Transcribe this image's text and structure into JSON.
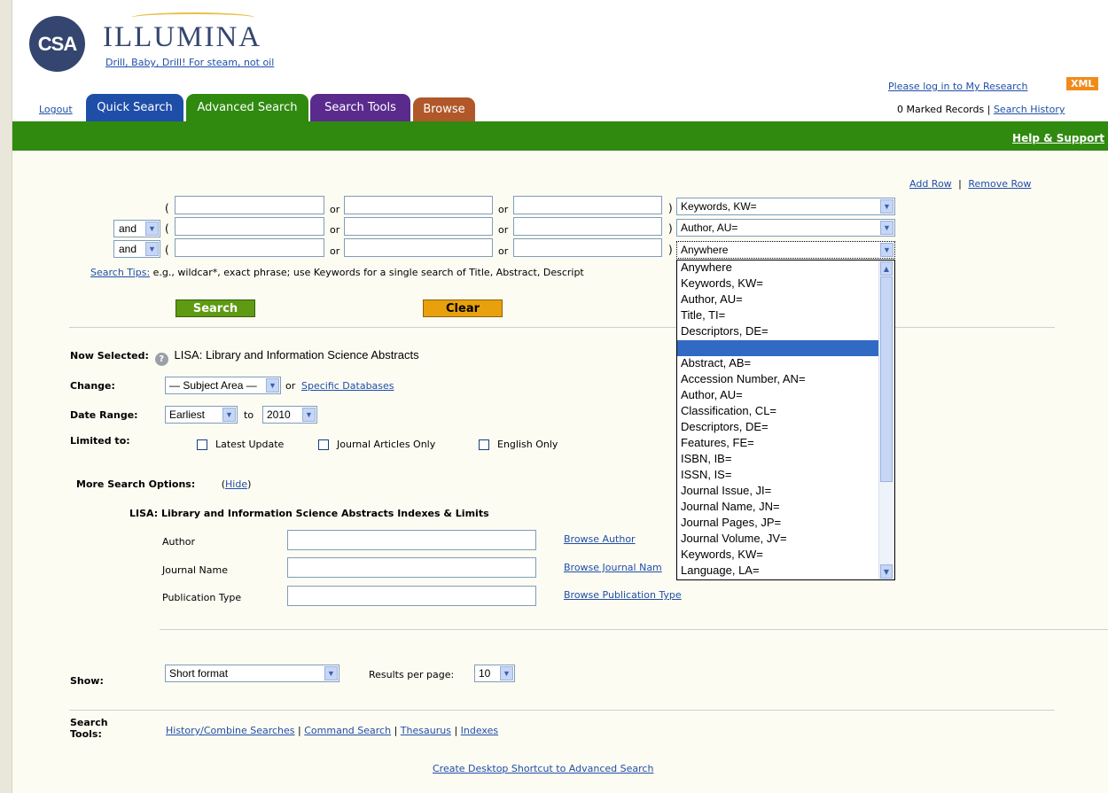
{
  "brand": {
    "logo": "CSA",
    "name": "ILLUMINA",
    "tagline": "Drill, Baby, Drill! For steam, not oil"
  },
  "nav": {
    "logout": "Logout",
    "tabs": [
      {
        "label": "Quick Search",
        "color": "#1f4ea8"
      },
      {
        "label": "Advanced Search",
        "color": "#2f8a0f"
      },
      {
        "label": "Search Tools",
        "color": "#5a2a8c"
      },
      {
        "label": "Browse",
        "color": "#b0582a"
      }
    ],
    "login_link": "Please log in to My Research",
    "xml": "XML",
    "marked_records": "0 Marked Records",
    "separator": "|",
    "search_history": "Search History",
    "help": "Help & Support"
  },
  "query": {
    "add_row": "Add Row",
    "remove_row": "Remove Row",
    "row_sep": "|",
    "open_paren": "(",
    "close_paren": ")",
    "or": "or",
    "rows": [
      {
        "operator": "",
        "field": "Keywords, KW="
      },
      {
        "operator": "and",
        "field": "Author, AU="
      },
      {
        "operator": "and",
        "field": "Anywhere"
      }
    ],
    "tips_label": "Search Tips:",
    "tips_text": "e.g., wildcar*, exact phrase; use Keywords for a single search of Title, Abstract, Descript",
    "search_button": "Search",
    "clear_button": "Clear"
  },
  "field_dropdown": {
    "items": [
      "Anywhere",
      "Keywords, KW=",
      "Author, AU=",
      "Title, TI=",
      "Descriptors, DE=",
      "",
      "Abstract, AB=",
      "Accession Number, AN=",
      "Author, AU=",
      "Classification, CL=",
      "Descriptors, DE=",
      "Features, FE=",
      "ISBN, IB=",
      "ISSN, IS=",
      "Journal Issue, JI=",
      "Journal Name, JN=",
      "Journal Pages, JP=",
      "Journal Volume, JV=",
      "Keywords, KW=",
      "Language, LA="
    ],
    "highlighted_index": 5
  },
  "options": {
    "now_selected_label": "Now Selected:",
    "now_selected_value": "LISA: Library and Information Science Abstracts",
    "change_label": "Change:",
    "subject_area": "— Subject Area —",
    "or": "or",
    "specific_databases": "Specific Databases",
    "date_range_label": "Date Range:",
    "date_from": "Earliest",
    "to": "to",
    "date_to": "2010",
    "limited_label": "Limited to:",
    "limits": [
      "Latest Update",
      "Journal Articles Only",
      "English Only"
    ],
    "more_options_label": "More Search Options:",
    "hide_open": "(",
    "hide": "Hide",
    "hide_close": ")"
  },
  "indexes": {
    "title": "LISA: Library and Information Science Abstracts Indexes & Limits",
    "rows": [
      {
        "label": "Author",
        "link": "Browse Author"
      },
      {
        "label": "Journal Name",
        "link": "Browse Journal Nam"
      },
      {
        "label": "Publication Type",
        "link": "Browse Publication Type"
      }
    ]
  },
  "show": {
    "label": "Show:",
    "format": "Short format",
    "results_label": "Results per page:",
    "results_value": "10"
  },
  "tools": {
    "label_line1": "Search",
    "label_line2": "Tools:",
    "links": [
      "History/Combine Searches",
      "Command Search",
      "Thesaurus",
      "Indexes"
    ],
    "sep": "|",
    "shortcut": "Create Desktop Shortcut to Advanced Search"
  }
}
